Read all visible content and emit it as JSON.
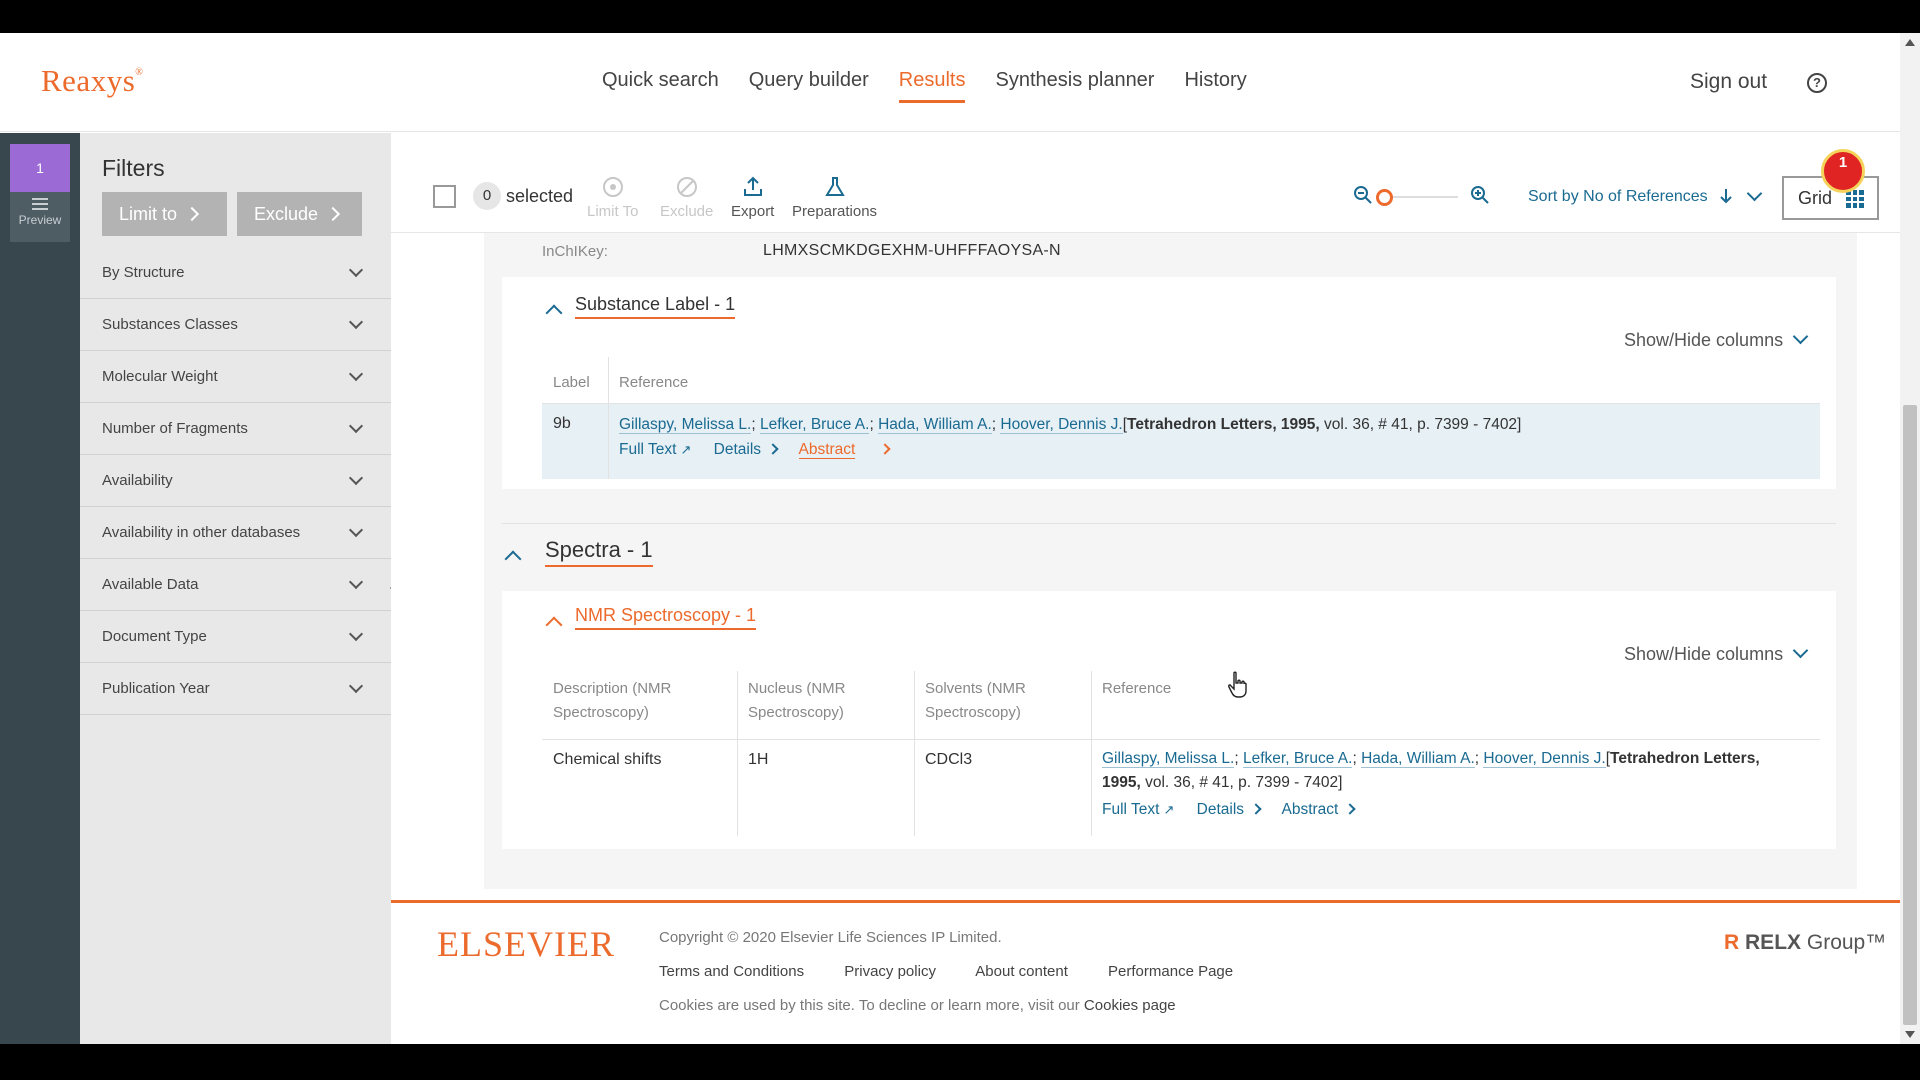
{
  "app": {
    "logo": "Reaxys",
    "logo_mark": "®"
  },
  "nav": {
    "items": [
      {
        "label": "Quick search",
        "active": false
      },
      {
        "label": "Query builder",
        "active": false
      },
      {
        "label": "Results",
        "active": true
      },
      {
        "label": "Synthesis planner",
        "active": false
      },
      {
        "label": "History",
        "active": false
      }
    ],
    "sign_out": "Sign out",
    "help_icon": "?"
  },
  "leftstrip": {
    "tab_number": "1",
    "preview_label": "Preview"
  },
  "filters": {
    "title": "Filters",
    "limit_to": "Limit to",
    "exclude": "Exclude",
    "items": [
      "By Structure",
      "Substances Classes",
      "Molecular Weight",
      "Number of Fragments",
      "Availability",
      "Availability in other databases",
      "Available Data",
      "Document Type",
      "Publication Year"
    ]
  },
  "toolbar": {
    "selected_count": "0",
    "selected_label": "selected",
    "limit_to": "Limit To",
    "exclude": "Exclude",
    "export": "Export",
    "preparations": "Preparations",
    "sort_label": "Sort by No of References",
    "grid_label": "Grid",
    "badge_count": "1"
  },
  "record": {
    "inchikey_label": "InChIKey:",
    "inchikey_value": "LHMXSCMKDGEXHM-UHFFFAOYSA-N"
  },
  "substance_label": {
    "title": "Substance Label - 1",
    "show_hide": "Show/Hide columns",
    "col_label": "Label",
    "col_reference": "Reference",
    "row": {
      "label": "9b",
      "authors": [
        "Gillaspy, Melissa L.",
        "Lefker, Bruce A.",
        "Hada, William A.",
        "Hoover, Dennis J."
      ],
      "journal": "Tetrahedron Letters, 1995,",
      "citation": " vol. 36, # 41, p. 7399 - 7402]",
      "full_text": "Full Text",
      "details": "Details",
      "abstract": "Abstract"
    }
  },
  "spectra": {
    "title": "Spectra - 1",
    "nmr_title": "NMR Spectroscopy - 1",
    "show_hide": "Show/Hide columns",
    "col_description": "Description (NMR Spectroscopy)",
    "col_nucleus": "Nucleus (NMR Spectroscopy)",
    "col_solvents": "Solvents (NMR Spectroscopy)",
    "col_reference": "Reference",
    "row": {
      "description": "Chemical shifts",
      "nucleus": "1H",
      "solvents": "CDCl3",
      "authors": [
        "Gillaspy, Melissa L.",
        "Lefker, Bruce A.",
        "Hada, William A.",
        "Hoover, Dennis J."
      ],
      "journal": "Tetrahedron Letters,",
      "year": "1995,",
      "citation": " vol. 36, # 41, p. 7399 - 7402]",
      "full_text": "Full Text",
      "details": "Details",
      "abstract": "Abstract"
    }
  },
  "footer": {
    "publisher": "ELSEVIER",
    "copyright": "Copyright © 2020 Elsevier Life Sciences IP Limited.",
    "links": [
      "Terms and Conditions",
      "Privacy policy",
      "About content",
      "Performance Page"
    ],
    "cookies_text": "Cookies are used by this site. To decline or learn more, visit our ",
    "cookies_link": "Cookies page",
    "relx_r": "R",
    "relx": "RELX",
    "relx_group": " Group™"
  },
  "colors": {
    "accent": "#ec6a2c",
    "link": "#1a6a91",
    "sidebar": "#38464e",
    "filters_bg": "#e8e8e8"
  }
}
